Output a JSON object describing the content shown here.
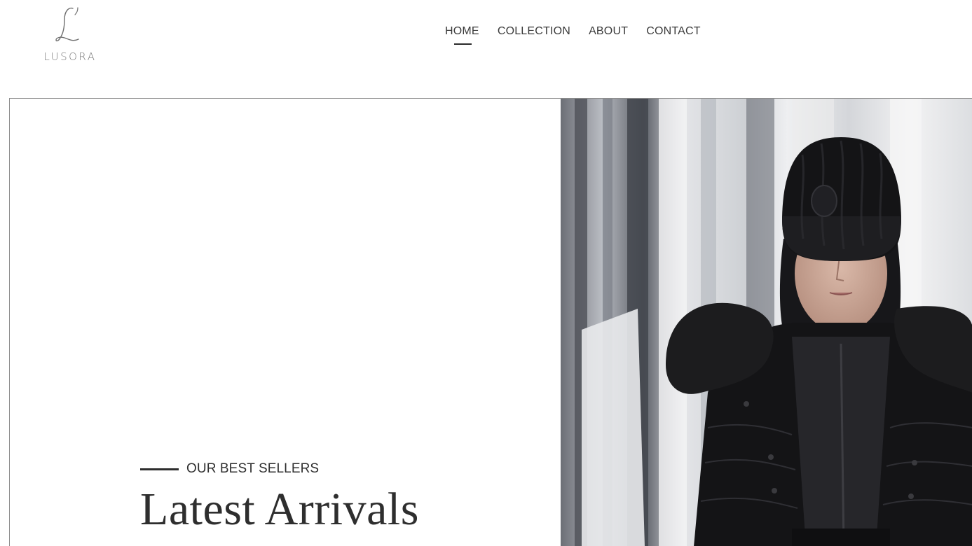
{
  "brand": {
    "mark": "L'",
    "name": "LUSORA"
  },
  "nav": {
    "items": [
      {
        "label": "HOME",
        "active": true
      },
      {
        "label": "COLLECTION",
        "active": false
      },
      {
        "label": "ABOUT",
        "active": false
      },
      {
        "label": "CONTACT",
        "active": false
      }
    ]
  },
  "hero": {
    "eyebrow": "OUR BEST SELLERS",
    "title": "Latest Arrivals",
    "image_subject": "model in black knit beanie and black puffer jacket with fur-trimmed hood"
  },
  "colors": {
    "text": "#2e2e2e",
    "nav_text": "#3a3a3a",
    "logo": "#7a7a7a",
    "background": "#ffffff"
  }
}
